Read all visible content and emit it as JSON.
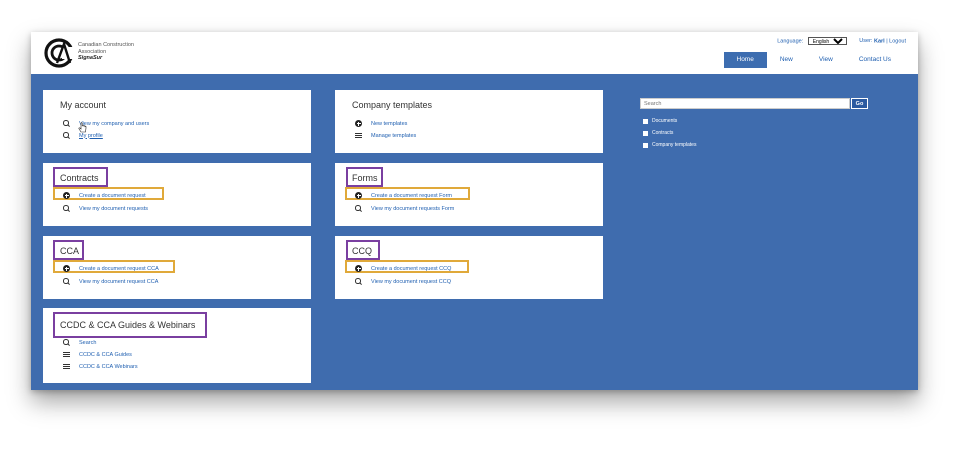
{
  "header": {
    "org_line1": "Canadian Construction",
    "org_line2": "Association",
    "brand": "SignaSur",
    "language_label": "Language:",
    "language_value": "English",
    "user_label": "User:",
    "user_name": "Karl",
    "separator": "|",
    "logout": "Logout"
  },
  "nav": {
    "home": "Home",
    "new": "New",
    "view": "View",
    "contact": "Contact Us"
  },
  "cards": {
    "my_account": {
      "title": "My account",
      "item1": "View my company and users",
      "item2": "My profile"
    },
    "company_templates": {
      "title": "Company templates",
      "item1": "New templates",
      "item2": "Manage templates"
    },
    "contracts": {
      "title": "Contracts",
      "item1": "Create a document request",
      "item2": "View my document requests"
    },
    "forms": {
      "title": "Forms",
      "item1": "Create a document request Form",
      "item2": "View my document requests Form"
    },
    "cca": {
      "title": "CCA",
      "item1": "Create a document request CCA",
      "item2": "View my document request CCA"
    },
    "ccq": {
      "title": "CCQ",
      "item1": "Create a document request CCQ",
      "item2": "View my document request CCQ"
    },
    "guides": {
      "title": "CCDC & CCA Guides & Webinars",
      "item1": "Search",
      "item2": "CCDC & CCA Guides",
      "item3": "CCDC & CCA Webinars"
    }
  },
  "search": {
    "placeholder": "Search",
    "go": "Go",
    "filters": [
      "Documents",
      "Contracts",
      "Company templates"
    ]
  },
  "colors": {
    "main_bg": "#3f6cae",
    "link": "#1f5fb0",
    "highlight_purple": "#7a3fa0",
    "highlight_gold": "#e0a93a"
  }
}
